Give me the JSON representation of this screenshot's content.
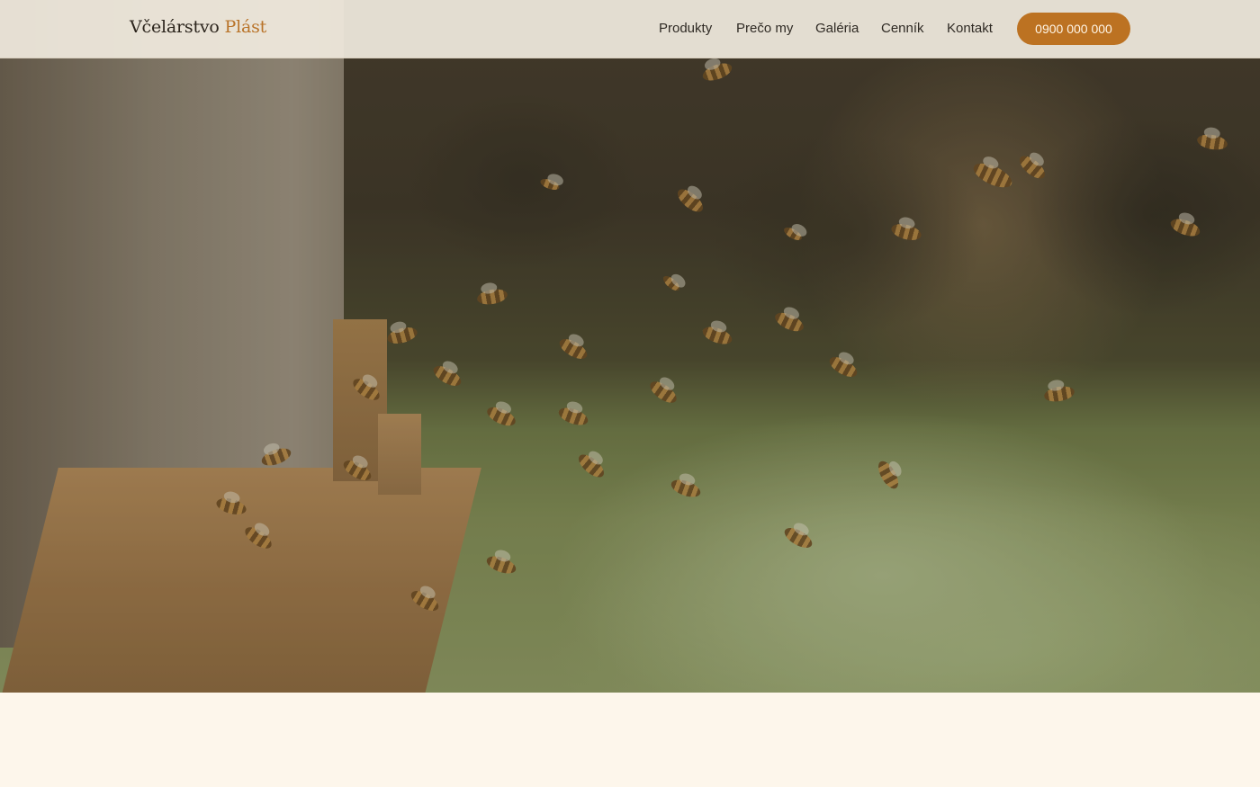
{
  "brand": {
    "name_main": "Včelárstvo",
    "name_accent": "Plást",
    "accent_color": "#b9742a"
  },
  "nav": {
    "items": [
      "Produkty",
      "Prečo my",
      "Galéria",
      "Cenník",
      "Kontakt"
    ],
    "phone_label": "0900 000 000",
    "phone_button_color": "#bc7222"
  },
  "hero": {
    "image_description_icon": "bees-photo"
  },
  "colors": {
    "page_background": "#fdf6eb"
  }
}
